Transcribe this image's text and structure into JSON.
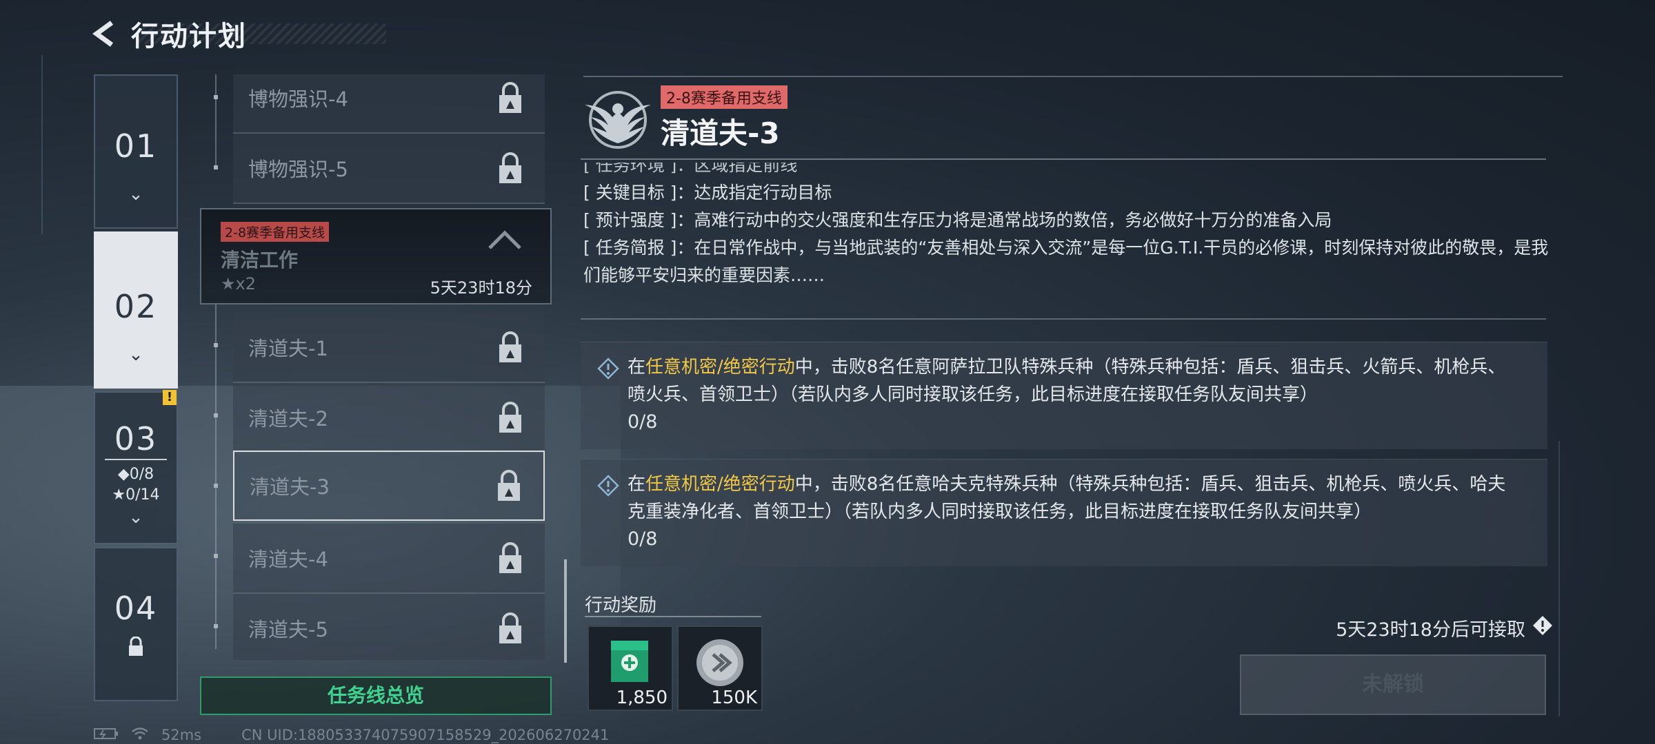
{
  "header": {
    "title": "行动计划"
  },
  "chapters": [
    {
      "num": "01"
    },
    {
      "num": "02"
    },
    {
      "num": "03",
      "warn": "!",
      "diamond": "◆0/8",
      "stars": "★0/14"
    },
    {
      "num": "04"
    }
  ],
  "missions": {
    "group_a": [
      "博物强识-4",
      "博物强识-5"
    ],
    "branch": {
      "tag": "2-8赛季备用支线",
      "name": "清洁工作",
      "stars": "★x2",
      "time": "5天23时18分"
    },
    "group_b": [
      "清道夫-1",
      "清道夫-2",
      "清道夫-3",
      "清道夫-4",
      "清道夫-5"
    ],
    "selected": "清道夫-3"
  },
  "overview_button": "任务线总览",
  "detail": {
    "tag": "2-8赛季备用支线",
    "title": "清道夫-3",
    "info_cut": "[ 任务环境 ]：区域指定前线",
    "info": [
      {
        "label": "[ 关键目标 ]",
        "value": "：达成指定行动目标"
      },
      {
        "label": "[ 预计强度 ]",
        "value": "：高难行动中的交火强度和生存压力将是通常战场的数倍，务必做好十万分的准备入局"
      },
      {
        "label": "[ 任务简报 ]",
        "value": "：在日常作战中，与当地武装的“友善相处与深入交流”是每一位G.T.I.干员的必修课，时刻保持对彼此的敬畏，是我们能够平安归来的重要因素……"
      }
    ],
    "objectives": [
      {
        "pre": "在",
        "highlight": "任意机密/绝密行动",
        "post": "中，击败8名任意阿萨拉卫队特殊兵种（特殊兵种包括：盾兵、狙击兵、火箭兵、机枪兵、喷火兵、首领卫士）（若队内多人同时接取该任务，此目标进度在接取任务队友间共享）",
        "progress": "0/8"
      },
      {
        "pre": "在",
        "highlight": "任意机密/绝密行动",
        "post": "中，击败8名任意哈夫克特殊兵种（特殊兵种包括：盾兵、狙击兵、机枪兵、喷火兵、哈夫克重装净化者、首领卫士）（若队内多人同时接取该任务，此目标进度在接取任务队友间共享）",
        "progress": "0/8"
      }
    ],
    "reward_title": "行动奖励",
    "rewards": [
      {
        "qty": "1,850",
        "icon": "green-crate-icon"
      },
      {
        "qty": "150K",
        "icon": "silver-coin-icon"
      }
    ],
    "unlock_hint": "5天23时18分后可接取",
    "locked_button": "未解锁"
  },
  "status": {
    "ping": "52ms",
    "uid": "CN UID:188053374075907158529_202606270241"
  },
  "colors": {
    "accent_green": "#3fd291",
    "tag_red": "#e06a6a",
    "highlight_yellow": "#f3c845"
  }
}
